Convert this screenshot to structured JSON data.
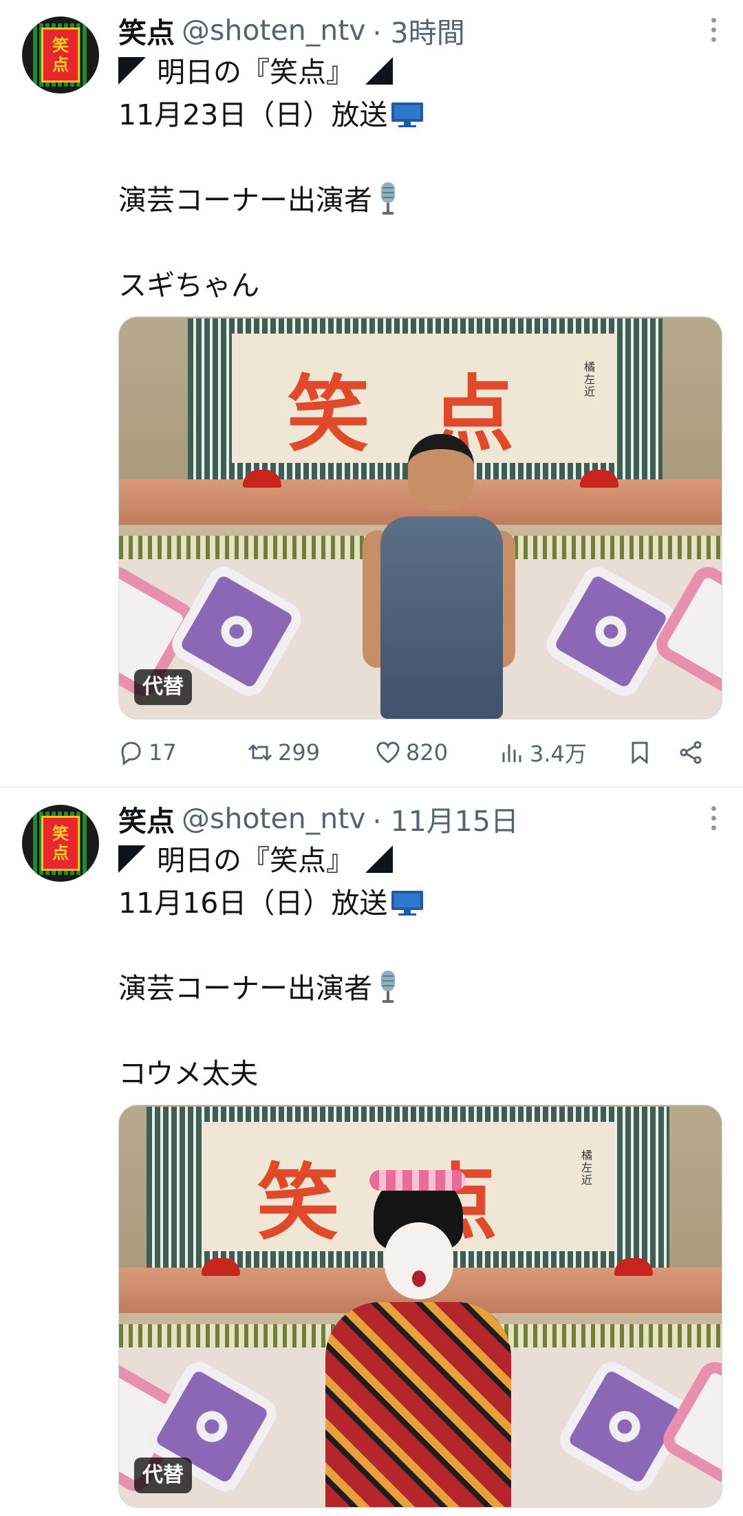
{
  "tweets": [
    {
      "author_name": "笑点",
      "handle": "@shoten_ntv",
      "time": "· 3時間",
      "line1": "明日の『笑点』",
      "line2": "11月23日（日）放送",
      "line3": "演芸コーナー出演者",
      "line4": "スギちゃん",
      "image_alt_badge": "代替",
      "stats": {
        "replies": "17",
        "retweets": "299",
        "likes": "820",
        "views": "3.4万"
      }
    },
    {
      "author_name": "笑点",
      "handle": "@shoten_ntv",
      "time": "· 11月15日",
      "line1": "明日の『笑点』",
      "line2": "11月16日（日）放送",
      "line3": "演芸コーナー出演者",
      "line4": "コウメ太夫",
      "image_alt_badge": "代替"
    }
  ],
  "avatar_text": [
    "笑",
    "点"
  ],
  "image_sign_text": [
    "笑",
    "点"
  ],
  "image_sign_signature": "橘左近",
  "icons": {
    "tv": "tv-icon",
    "mic": "microphone-icon",
    "more": "more-vertical-icon",
    "reply": "reply-icon",
    "retweet": "retweet-icon",
    "like": "heart-icon",
    "views": "views-chart-icon",
    "bookmark": "bookmark-icon",
    "share": "share-icon"
  },
  "colors": {
    "text": "#0f1419",
    "muted": "#536471",
    "divider": "#eff3f4"
  }
}
